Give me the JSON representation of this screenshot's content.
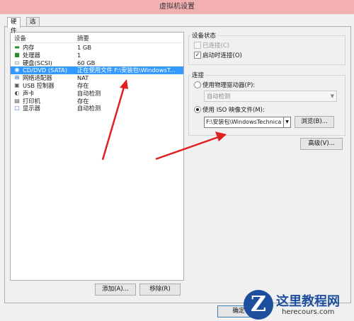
{
  "window": {
    "title": "虚拟机设置"
  },
  "tabs": [
    {
      "label": "硬件"
    },
    {
      "label": "选项"
    }
  ],
  "device_list": {
    "col_device": "设备",
    "col_summary": "摘要",
    "rows": [
      {
        "name": "内存",
        "summary": "1 GB",
        "icon": "memory-icon",
        "glyph": "▬",
        "color": "#2a8a2a"
      },
      {
        "name": "处理器",
        "summary": "1",
        "icon": "processor-icon",
        "glyph": "■",
        "color": "#2a8a2a"
      },
      {
        "name": "硬盘(SCSI)",
        "summary": "60 GB",
        "icon": "hard-disk-icon",
        "glyph": "▭",
        "color": "#555555"
      },
      {
        "name": "CD/DVD (SATA)",
        "summary": "正在使用文件 F:\\安装包\\WindowsT...",
        "icon": "cd-dvd-icon",
        "glyph": "◉",
        "color": "#ffffff",
        "selected": true
      },
      {
        "name": "网络适配器",
        "summary": "NAT",
        "icon": "network-adapter-icon",
        "glyph": "⊞",
        "color": "#2a6ac8"
      },
      {
        "name": "USB 控制器",
        "summary": "存在",
        "icon": "usb-controller-icon",
        "glyph": "▣",
        "color": "#555555"
      },
      {
        "name": "声卡",
        "summary": "自动检测",
        "icon": "sound-card-icon",
        "glyph": "◐",
        "color": "#555555"
      },
      {
        "name": "打印机",
        "summary": "存在",
        "icon": "printer-icon",
        "glyph": "▤",
        "color": "#555555"
      },
      {
        "name": "显示器",
        "summary": "自动检测",
        "icon": "display-icon",
        "glyph": "▢",
        "color": "#2a6ac8"
      }
    ]
  },
  "buttons": {
    "add": "添加(A)...",
    "remove": "移除(R)",
    "browse": "浏览(B)...",
    "advanced": "高级(V)...",
    "ok": "确定"
  },
  "device_status": {
    "title": "设备状态",
    "connected": "已连接(C)",
    "connect_at_power_on": "启动时连接(O)"
  },
  "connection": {
    "title": "连接",
    "use_physical_drive": "使用物理驱动器(P):",
    "physical_drive_value": "自动检测",
    "use_iso": "使用 ISO 映像文件(M):",
    "iso_path": "F:\\安装包\\WindowsTechnica"
  },
  "watermark": {
    "logo_letter": "Z",
    "name": "这里教程网",
    "url": "herecours.com"
  }
}
